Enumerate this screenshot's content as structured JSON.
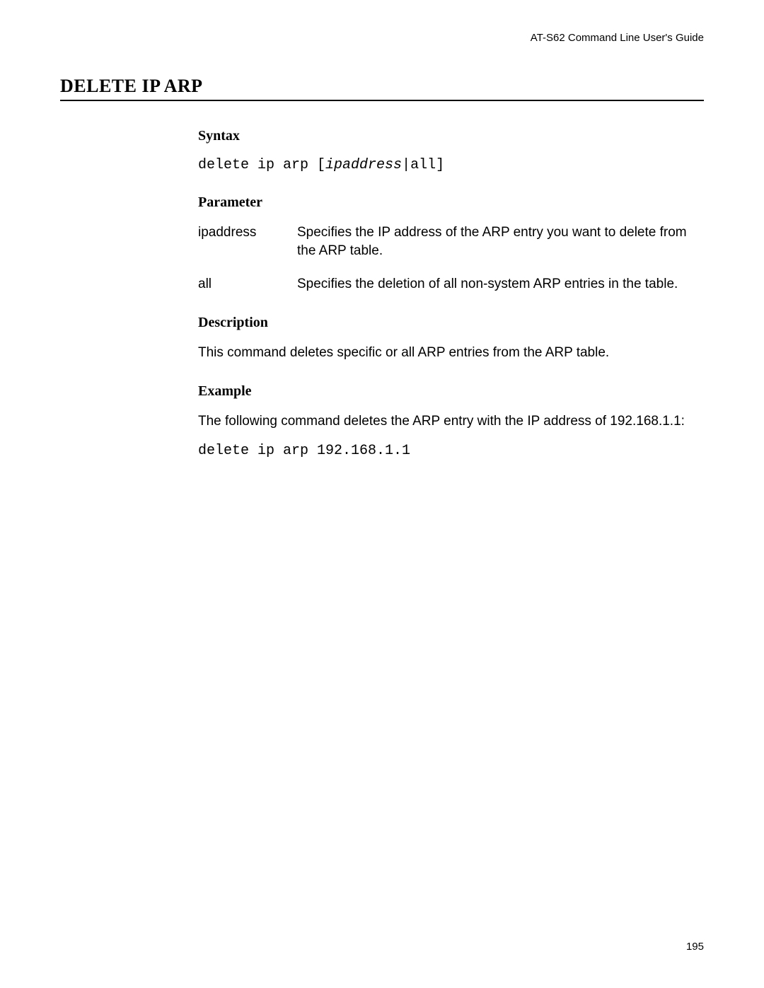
{
  "header": "AT-S62 Command Line User's Guide",
  "title": "DELETE IP ARP",
  "sections": {
    "syntax": {
      "heading": "Syntax",
      "prefix": "delete ip arp [",
      "italic": "ipaddress",
      "suffix": "|all]"
    },
    "parameter": {
      "heading": "Parameter",
      "rows": [
        {
          "name": "ipaddress",
          "desc": "Specifies the IP address of the ARP entry you want to delete from the ARP table."
        },
        {
          "name": "all",
          "desc": "Specifies the deletion of all non-system ARP entries in the table."
        }
      ]
    },
    "description": {
      "heading": "Description",
      "text": "This command deletes specific or all ARP entries from the ARP table."
    },
    "example": {
      "heading": "Example",
      "text": "The following command deletes the ARP entry with the IP address of 192.168.1.1:",
      "code": "delete ip arp 192.168.1.1"
    }
  },
  "page_number": "195"
}
